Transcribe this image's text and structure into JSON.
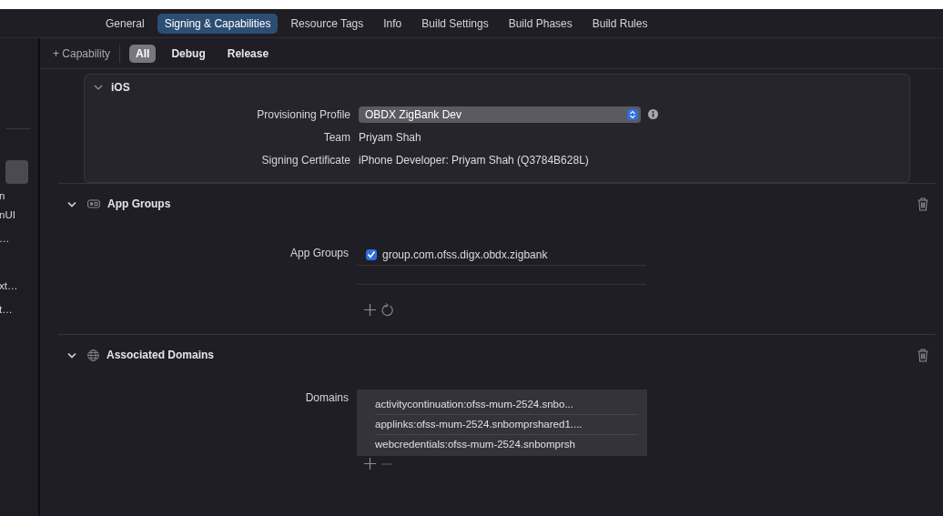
{
  "tabs": [
    {
      "label": "General",
      "selected": false
    },
    {
      "label": "Signing & Capabilities",
      "selected": true
    },
    {
      "label": "Resource Tags",
      "selected": false
    },
    {
      "label": "Info",
      "selected": false
    },
    {
      "label": "Build Settings",
      "selected": false
    },
    {
      "label": "Build Phases",
      "selected": false
    },
    {
      "label": "Build Rules",
      "selected": false
    }
  ],
  "filter": {
    "add_label": "+ Capability",
    "options": [
      {
        "label": "All",
        "selected": true
      },
      {
        "label": "Debug",
        "selected": false
      },
      {
        "label": "Release",
        "selected": false
      }
    ]
  },
  "sidebar": {
    "items": [
      {
        "text": "n"
      },
      {
        "text": "nUI"
      },
      {
        "text": "…"
      },
      {
        "text": "xt…"
      },
      {
        "text": "t…"
      }
    ]
  },
  "ios": {
    "title": "iOS",
    "expanded": true,
    "fields": [
      {
        "kind": "popup",
        "label": "Provisioning Profile",
        "value": "OBDX ZigBank Dev"
      },
      {
        "kind": "text",
        "label": "Team",
        "value": "Priyam Shah"
      },
      {
        "kind": "text",
        "label": "Signing Certificate",
        "value": "iPhone Developer: Priyam Shah (Q3784B628L)"
      }
    ]
  },
  "sections": [
    {
      "kind": "app_groups",
      "title": "App Groups",
      "expanded": true,
      "label": "App Groups",
      "items": [
        {
          "text": "group.com.ofss.digx.obdx.zigbank",
          "checked": true
        }
      ]
    },
    {
      "kind": "domains",
      "title": "Associated Domains",
      "expanded": true,
      "label": "Domains",
      "items": [
        {
          "text": "activitycontinuation:ofss-mum-2524.snbo..."
        },
        {
          "text": "applinks:ofss-mum-2524.snbomprshared1...."
        },
        {
          "text": "webcredentials:ofss-mum-2524.snbomprsh"
        }
      ]
    }
  ]
}
